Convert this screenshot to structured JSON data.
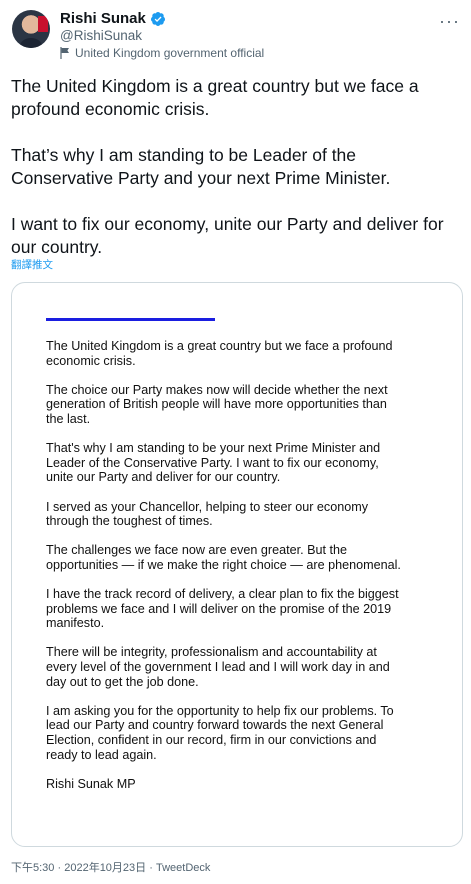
{
  "author": {
    "name": "Rishi Sunak",
    "handle": "@RishiSunak",
    "label": "United Kingdom government official",
    "icons": {
      "verified": "verified-badge-icon",
      "label": "flag-icon",
      "more": "more-options-icon"
    },
    "accent_color": "#1d9bf0"
  },
  "tweet": {
    "paragraphs": [
      "The United Kingdom is a great country but we face a profound economic crisis.",
      "That’s why I am standing to be Leader of the Conservative Party and your next Prime Minister.",
      "I want to fix our economy, unite our Party and deliver for our country."
    ],
    "translate_label": "翻譯推文"
  },
  "letter": {
    "bar_color": "#1a1ee0",
    "paragraphs": [
      "The United Kingdom is a great country but we face a profound economic crisis.",
      "The choice our Party makes now will decide whether the next generation of British people will have more opportunities than the last.",
      "That's why I am standing to be your next Prime Minister and Leader of the Conservative Party. I want to fix our economy, unite our Party and deliver for our country.",
      "I served as your Chancellor, helping to steer our economy through the toughest of times.",
      "The challenges we face now are even greater. But the opportunities — if we make the right choice — are phenomenal.",
      "I have the track record of delivery, a clear plan to fix the biggest problems we face and I will deliver on the promise of the 2019 manifesto.",
      "There will be integrity, professionalism and accountability at every level of the government I lead and I will work day in and day out to get the job done.",
      "I am asking you for the opportunity to help fix our problems. To lead our Party and country forward towards the next General Election, confident in our record, firm in our convictions and ready to lead again.",
      "Rishi Sunak MP"
    ]
  },
  "footer": {
    "time": "下午5:30",
    "separator": "·",
    "date": "2022年10月23日",
    "source": "TweetDeck"
  }
}
